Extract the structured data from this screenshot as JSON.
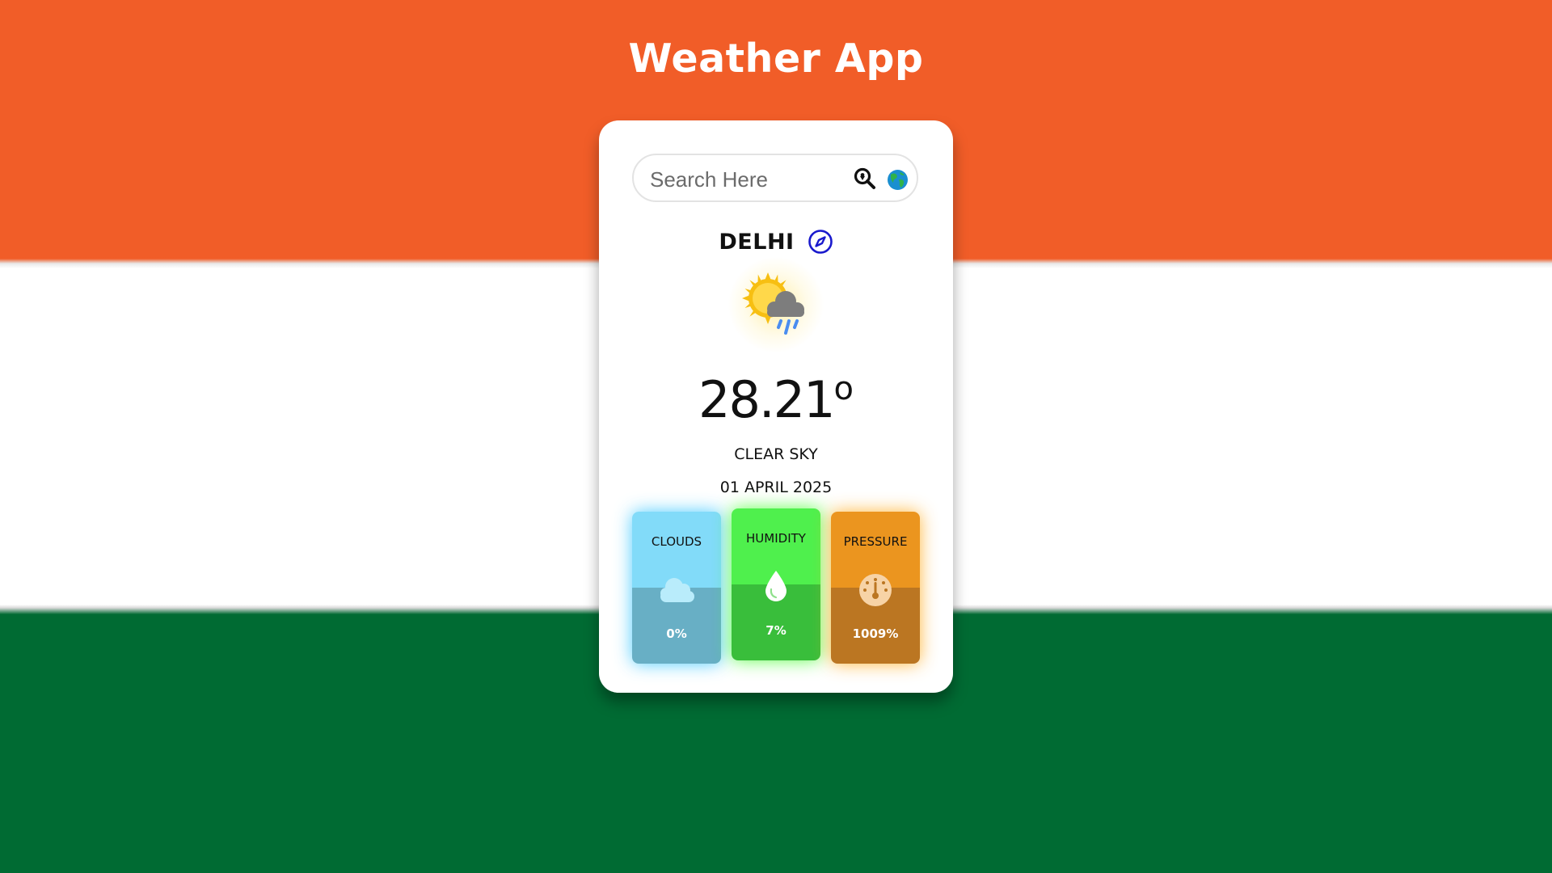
{
  "header": {
    "title": "Weather App"
  },
  "search": {
    "placeholder": "Search Here",
    "value": ""
  },
  "location": {
    "city": "DELHI"
  },
  "current": {
    "temperature": "28.21",
    "degree_symbol": "o",
    "description": "CLEAR SKY",
    "date": "01 APRIL 2025"
  },
  "stats": {
    "clouds": {
      "label": "CLOUDS",
      "value": "0%"
    },
    "humidity": {
      "label": "HUMIDITY",
      "value": "7%"
    },
    "pressure": {
      "label": "PRESSURE",
      "value": "1009%"
    }
  },
  "icons": {
    "search": "search-location-icon",
    "globe": "globe-icon",
    "compass": "compass-icon",
    "weather": "sun-cloud-rain-icon",
    "clouds": "cloud-icon",
    "humidity": "droplet-icon",
    "pressure": "gauge-icon"
  },
  "colors": {
    "flag_top": "#f15d28",
    "flag_middle": "#ffffff",
    "flag_bottom": "#006b33",
    "clouds_tile": "#82dbf9",
    "humidity_tile": "#4ff04d",
    "pressure_tile": "#eb951f"
  }
}
